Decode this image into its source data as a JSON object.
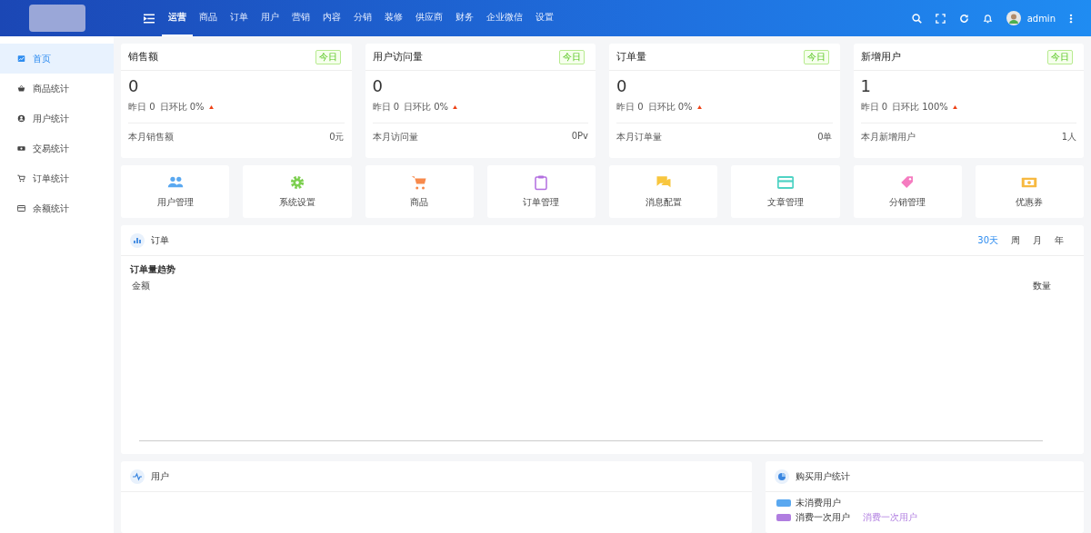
{
  "header": {
    "nav": [
      {
        "label": "运营",
        "selected": true
      },
      {
        "label": "商品",
        "selected": false
      },
      {
        "label": "订单",
        "selected": false
      },
      {
        "label": "用户",
        "selected": false
      },
      {
        "label": "营销",
        "selected": false
      },
      {
        "label": "内容",
        "selected": false
      },
      {
        "label": "分销",
        "selected": false
      },
      {
        "label": "装修",
        "selected": false
      },
      {
        "label": "供应商",
        "selected": false
      },
      {
        "label": "财务",
        "selected": false
      },
      {
        "label": "企业微信",
        "selected": false
      },
      {
        "label": "设置",
        "selected": false
      }
    ],
    "user": "admin"
  },
  "sidebar": {
    "items": [
      {
        "label": "首页",
        "selected": true
      },
      {
        "label": "商品统计",
        "selected": false
      },
      {
        "label": "用户统计",
        "selected": false
      },
      {
        "label": "交易统计",
        "selected": false
      },
      {
        "label": "订单统计",
        "selected": false
      },
      {
        "label": "余额统计",
        "selected": false
      }
    ]
  },
  "stats": [
    {
      "title": "销售额",
      "badge": "今日",
      "value": "0",
      "yesterday": "昨日 0",
      "ratio": "日环比 0%",
      "footer_label": "本月销售额",
      "footer_value": "0元"
    },
    {
      "title": "用户访问量",
      "badge": "今日",
      "value": "0",
      "yesterday": "昨日 0",
      "ratio": "日环比 0%",
      "footer_label": "本月访问量",
      "footer_value": "0Pv"
    },
    {
      "title": "订单量",
      "badge": "今日",
      "value": "0",
      "yesterday": "昨日 0",
      "ratio": "日环比 0%",
      "footer_label": "本月订单量",
      "footer_value": "0单"
    },
    {
      "title": "新增用户",
      "badge": "今日",
      "value": "1",
      "yesterday": "昨日 0",
      "ratio": "日环比 100%",
      "footer_label": "本月新增用户",
      "footer_value": "1人"
    }
  ],
  "shortcuts": [
    {
      "label": "用户管理",
      "color": "#5aa8f0"
    },
    {
      "label": "系统设置",
      "color": "#7ccf4f"
    },
    {
      "label": "商品",
      "color": "#f78a4c"
    },
    {
      "label": "订单管理",
      "color": "#b26ee0"
    },
    {
      "label": "消息配置",
      "color": "#f8c63e"
    },
    {
      "label": "文章管理",
      "color": "#4fd3c4"
    },
    {
      "label": "分销管理",
      "color": "#f57cc0"
    },
    {
      "label": "优惠券",
      "color": "#f7b940"
    }
  ],
  "order_panel": {
    "title": "订单",
    "periods": [
      {
        "label": "30天",
        "selected": true
      },
      {
        "label": "周",
        "selected": false
      },
      {
        "label": "月",
        "selected": false
      },
      {
        "label": "年",
        "selected": false
      }
    ],
    "chart_title": "订单量趋势",
    "left_axis": "金额",
    "right_axis": "数量"
  },
  "user_panel": {
    "title": "用户"
  },
  "buyer_panel": {
    "title": "购买用户统计",
    "legend": [
      {
        "label": "未消费用户",
        "color": "#5aa8f0"
      },
      {
        "label": "消费一次用户",
        "color": "#b07de0"
      }
    ],
    "slice_label": "消费一次用户"
  }
}
